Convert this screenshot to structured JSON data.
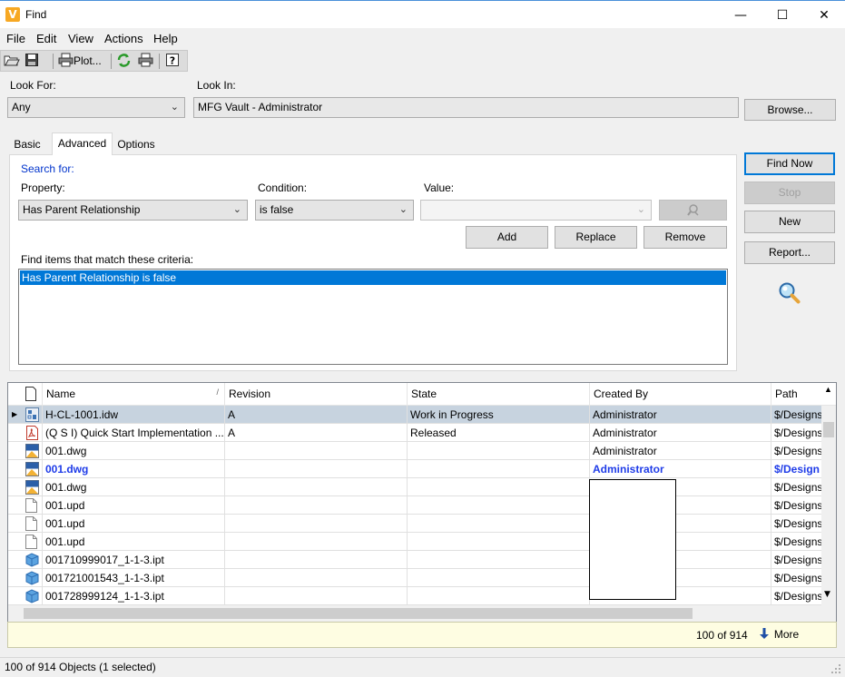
{
  "window": {
    "title": "Find",
    "app_icon_letter": "V",
    "minimize_glyph": "—",
    "maximize_glyph": "☐",
    "close_glyph": "✕"
  },
  "menu": [
    "File",
    "Edit",
    "View",
    "Actions",
    "Help"
  ],
  "toolbar": {
    "open_icon": "folder-open-icon",
    "save_icon": "save-icon",
    "plot_label": "Plot...",
    "refresh_icon": "refresh-icon",
    "print_icon": "print-icon",
    "help_icon": "help-icon"
  },
  "look_for": {
    "label": "Look For:",
    "value": "Any"
  },
  "look_in": {
    "label": "Look In:",
    "value": "MFG Vault - Administrator",
    "browse_label": "Browse..."
  },
  "tabs": [
    "Basic",
    "Advanced",
    "Options"
  ],
  "active_tab": "Advanced",
  "advanced": {
    "search_for_label": "Search for:",
    "property_label": "Property:",
    "property_value": "Has Parent Relationship",
    "condition_label": "Condition:",
    "condition_value": "is false",
    "value_label": "Value:",
    "value_value": "",
    "add_label": "Add",
    "replace_label": "Replace",
    "remove_label": "Remove",
    "criteria_label": "Find items that match these criteria:",
    "criteria": [
      "Has Parent Relationship is false"
    ]
  },
  "actions": {
    "find_now": "Find Now",
    "stop": "Stop",
    "new": "New",
    "report": "Report..."
  },
  "grid": {
    "columns": [
      "Name",
      "Revision",
      "State",
      "Created By",
      "Path"
    ],
    "rows": [
      {
        "icon": "drawing-idw-icon",
        "name": "H-CL-1001.idw",
        "revision": "A",
        "state": "Work in Progress",
        "created_by": "Administrator",
        "path": "$/Designs"
      },
      {
        "icon": "pdf-icon",
        "name": "(Q S I) Quick Start Implementation ...",
        "revision": "A",
        "state": "Released",
        "created_by": "Administrator",
        "path": "$/Designs"
      },
      {
        "icon": "dwg-icon",
        "name": "001.dwg",
        "revision": "",
        "state": "",
        "created_by": "Administrator",
        "path": "$/Designs"
      },
      {
        "icon": "dwg-icon",
        "name": "001.dwg",
        "revision": "",
        "state": "",
        "created_by": "Administrator",
        "path": "$/Design"
      },
      {
        "icon": "dwg-icon",
        "name": "001.dwg",
        "revision": "",
        "state": "",
        "created_by": "",
        "path": "$/Designs"
      },
      {
        "icon": "file-icon",
        "name": "001.upd",
        "revision": "",
        "state": "",
        "created_by": "",
        "path": "$/Designs"
      },
      {
        "icon": "file-icon",
        "name": "001.upd",
        "revision": "",
        "state": "",
        "created_by": "",
        "path": "$/Designs"
      },
      {
        "icon": "file-icon",
        "name": "001.upd",
        "revision": "",
        "state": "",
        "created_by": "",
        "path": "$/Designs"
      },
      {
        "icon": "part-ipt-icon",
        "name": "001710999017_1-1-3.ipt",
        "revision": "",
        "state": "",
        "created_by": "",
        "path": "$/Designs"
      },
      {
        "icon": "part-ipt-icon",
        "name": "001721001543_1-1-3.ipt",
        "revision": "",
        "state": "",
        "created_by": "",
        "path": "$/Designs"
      },
      {
        "icon": "part-ipt-icon",
        "name": "001728999124_1-1-3.ipt",
        "revision": "",
        "state": "",
        "created_by": "",
        "path": "$/Designs"
      }
    ]
  },
  "results": {
    "count_text": "100 of 914",
    "more_label": "More"
  },
  "status": {
    "text": "100 of 914 Objects (1 selected)"
  }
}
